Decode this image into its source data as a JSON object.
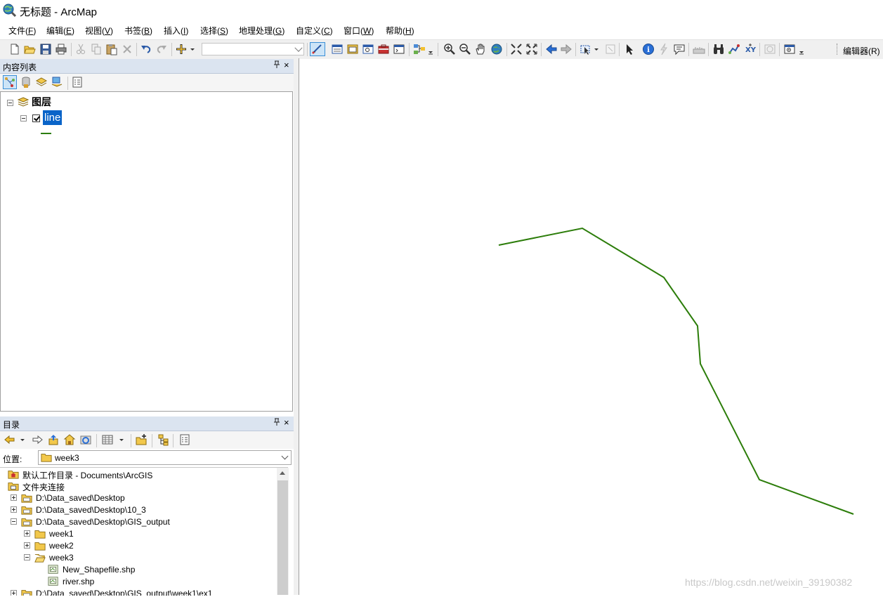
{
  "window": {
    "title": "无标题 - ArcMap"
  },
  "menu": [
    {
      "label": "文件(",
      "key": "F",
      "end": ")"
    },
    {
      "label": "编辑(",
      "key": "E",
      "end": ")"
    },
    {
      "label": "视图(",
      "key": "V",
      "end": ")"
    },
    {
      "label": "书签(",
      "key": "B",
      "end": ")"
    },
    {
      "label": "插入(",
      "key": "I",
      "end": ")"
    },
    {
      "label": "选择(",
      "key": "S",
      "end": ")"
    },
    {
      "label": "地理处理(",
      "key": "G",
      "end": ")"
    },
    {
      "label": "自定义(",
      "key": "C",
      "end": ")"
    },
    {
      "label": "窗口(",
      "key": "W",
      "end": ")"
    },
    {
      "label": "帮助(",
      "key": "H",
      "end": ")"
    }
  ],
  "toolbar": {
    "scale_value": "",
    "editor_label": "编辑器(R)"
  },
  "toc": {
    "title": "内容列表",
    "pin": "ᵖ",
    "close": "×",
    "group_label": "图层",
    "layer_label": "line",
    "layer_checked": true,
    "line_color": "#2c7d0a"
  },
  "catalog": {
    "title": "目录",
    "pin": "ᵖ",
    "close": "×",
    "location_label": "位置:",
    "location_value": "week3",
    "tree": [
      {
        "label": "默认工作目录 - Documents\\ArcGIS",
        "icon": "home-folder-icon",
        "expander": "none"
      },
      {
        "label": "文件夹连接",
        "icon": "folder-connections-icon",
        "expander": "none"
      },
      {
        "label": "D:\\Data_saved\\Desktop",
        "icon": "folder-icon",
        "expander": "plus"
      },
      {
        "label": "D:\\Data_saved\\Desktop\\10_3",
        "icon": "folder-icon",
        "expander": "plus"
      },
      {
        "label": "D:\\Data_saved\\Desktop\\GIS_output",
        "icon": "folder-icon",
        "expander": "minus"
      },
      {
        "label": "week1",
        "icon": "folder-icon",
        "expander": "plus"
      },
      {
        "label": "week2",
        "icon": "folder-icon",
        "expander": "plus"
      },
      {
        "label": "week3",
        "icon": "folder-open-icon",
        "expander": "minus"
      },
      {
        "label": "New_Shapefile.shp",
        "icon": "shapefile-icon",
        "expander": "none"
      },
      {
        "label": "river.shp",
        "icon": "shapefile-icon",
        "expander": "none"
      },
      {
        "label": "D:\\Data_saved\\Desktop\\GIS_output\\week1\\ex1",
        "icon": "folder-icon",
        "expander": "plus"
      }
    ]
  },
  "map": {
    "line_color": "#2c7d0a"
  },
  "watermark": "https://blog.csdn.net/weixin_39190382"
}
